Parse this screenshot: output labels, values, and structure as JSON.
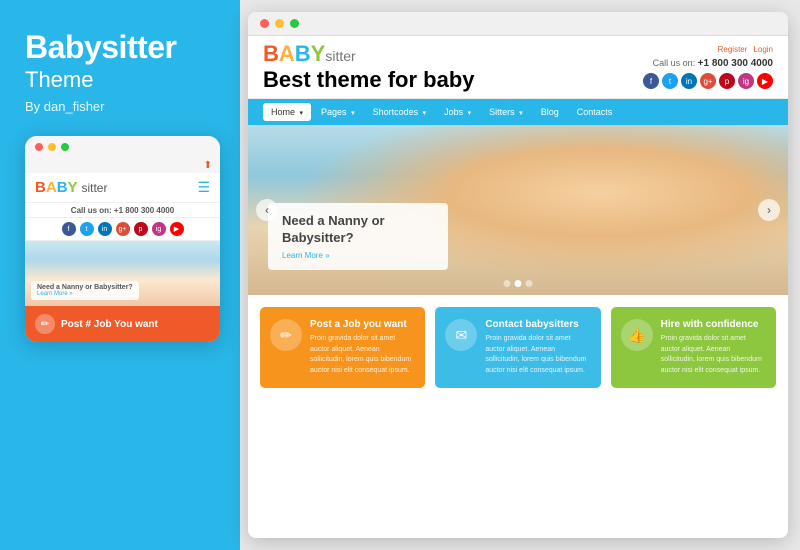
{
  "left": {
    "title": "Babysitter",
    "subtitle": "Theme",
    "author": "By dan_fisher"
  },
  "mobile": {
    "logo": {
      "baby": "BABY",
      "sitter": "sitter"
    },
    "phone_label": "Call us on:",
    "phone": "+1 800 300 4000",
    "hero_title": "Need a Nanny or Babysitter?",
    "hero_link": "Learn More »",
    "card_label": "Post # Job You want"
  },
  "browser": {
    "logo": {
      "baby": "BABY",
      "sitter": "sitter",
      "tagline": "Best theme for baby"
    },
    "header": {
      "register": "Register",
      "login": "Login",
      "call_label": "Call us on:",
      "phone": "+1 800 300 4000"
    },
    "nav": [
      {
        "label": "Home",
        "active": true,
        "arrow": true
      },
      {
        "label": "Pages",
        "active": false,
        "arrow": true
      },
      {
        "label": "Shortcodes",
        "active": false,
        "arrow": true
      },
      {
        "label": "Jobs",
        "active": false,
        "arrow": true
      },
      {
        "label": "Sitters",
        "active": false,
        "arrow": true
      },
      {
        "label": "Blog",
        "active": false,
        "arrow": false
      },
      {
        "label": "Contacts",
        "active": false,
        "arrow": false
      }
    ],
    "hero": {
      "title": "Need a Nanny or Babysitter?",
      "link": "Learn More »"
    },
    "cards": [
      {
        "id": "orange",
        "icon": "✏",
        "title": "Post a Job you want",
        "text": "Proin gravida dolor sit amet auctor aliquet. Aenean sollicitudin, lorem quis bibendum auctor nisi elit consequat ipsum.",
        "color": "bc-orange"
      },
      {
        "id": "blue",
        "icon": "✉",
        "title": "Contact babysitters",
        "text": "Proin gravida dolor sit amet auctor aliquet. Aenean sollicitudin, lorem quis bibendum auctor nisi elit consequat ipsum.",
        "color": "bc-blue"
      },
      {
        "id": "green",
        "icon": "👍",
        "title": "Hire with confidence",
        "text": "Proin gravida dolor sit amet auctor aliquet. Aenean sollicitudin, lorem quis bibendum auctor nisi elit consequat ipsum.",
        "color": "bc-green"
      }
    ]
  }
}
